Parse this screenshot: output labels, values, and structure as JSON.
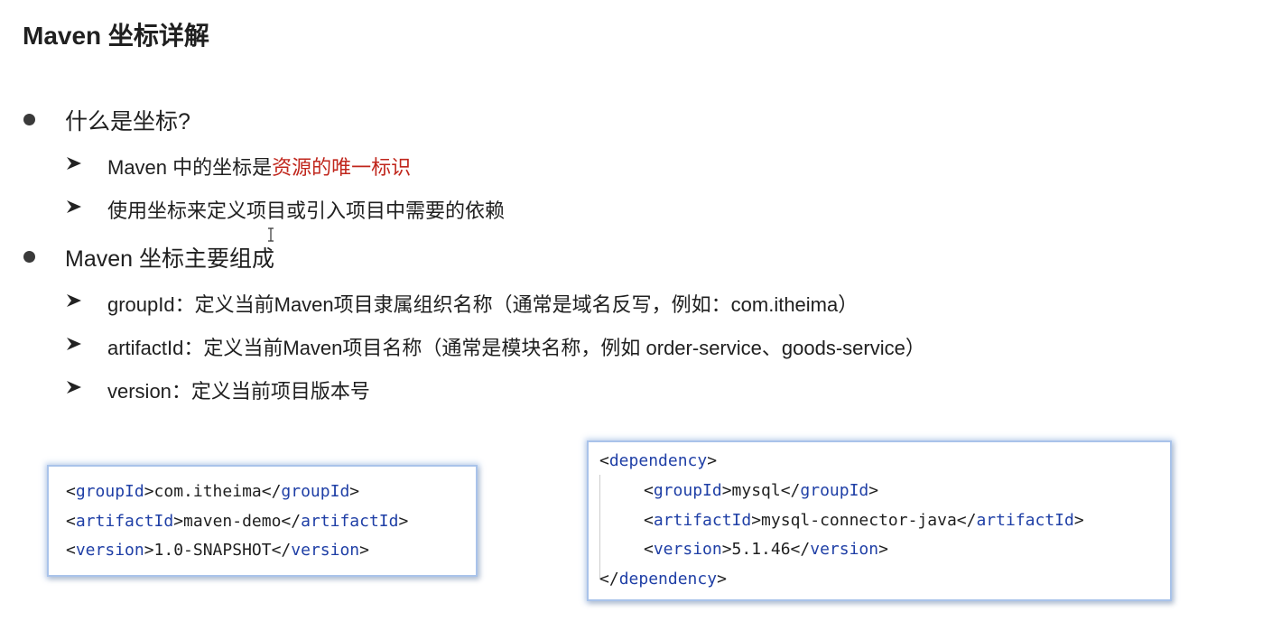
{
  "slide": {
    "title": "Maven 坐标详解"
  },
  "section1": {
    "heading": "什么是坐标?",
    "items": [
      {
        "text_plain": "Maven 中的坐标是",
        "text_highlight": "资源的唯一标识"
      },
      {
        "text_plain": "使用坐标来定义项目或引入项目中需要的依赖"
      }
    ]
  },
  "section2": {
    "heading": "Maven 坐标主要组成",
    "items": [
      {
        "text": "groupId：定义当前Maven项目隶属组织名称（通常是域名反写，例如：com.itheima）"
      },
      {
        "text": "artifactId：定义当前Maven项目名称（通常是模块名称，例如 order-service、goods-service）"
      },
      {
        "text": "version：定义当前项目版本号"
      }
    ]
  },
  "code_left": {
    "lines": [
      {
        "open": "<",
        "tag": "groupId",
        "mid": ">com.itheima</",
        "close_tag": "groupId",
        "end": ">"
      },
      {
        "open": "<",
        "tag": "artifactId",
        "mid": ">maven-demo</",
        "close_tag": "artifactId",
        "end": ">"
      },
      {
        "open": "<",
        "tag": "version",
        "mid": ">1.0-SNAPSHOT</",
        "close_tag": "version",
        "end": ">"
      }
    ]
  },
  "code_right": {
    "line1": {
      "open": "<",
      "tag": "dependency",
      "end": ">"
    },
    "line2": {
      "open": "<",
      "tag": "groupId",
      "mid": ">mysql</",
      "close_tag": "groupId",
      "end": ">"
    },
    "line3": {
      "open": "<",
      "tag": "artifactId",
      "mid": ">mysql-connector-java</",
      "close_tag": "artifactId",
      "end": ">"
    },
    "line4": {
      "open": "<",
      "tag": "version",
      "mid": ">5.1.46</",
      "close_tag": "version",
      "end": ">"
    },
    "line5": {
      "open": "</",
      "tag": "dependency",
      "end": ">"
    }
  },
  "colors": {
    "highlight": "#c0261c",
    "xml_tag": "#1f3fa6",
    "code_border": "#a9c3ea"
  },
  "icons": {
    "bullet": "filled-circle-bullet",
    "sub_bullet": "arrowhead-bullet",
    "cursor": "text-cursor-icon"
  }
}
